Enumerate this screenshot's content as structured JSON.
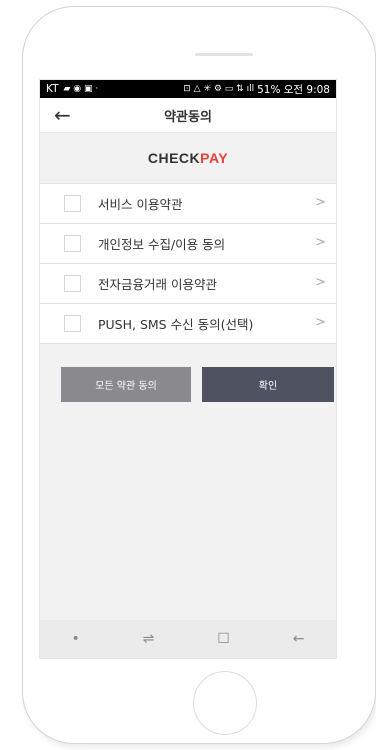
{
  "status": {
    "carrier": "KT",
    "right": "51% 오전 9:08"
  },
  "header": {
    "title": "약관동의"
  },
  "brand": {
    "part1": "CHECK",
    "part2": "PAY"
  },
  "terms": [
    {
      "label": "서비스 이용약관"
    },
    {
      "label": "개인정보 수집/이용 동의"
    },
    {
      "label": "전자금융거래 이용약관"
    },
    {
      "label": "PUSH, SMS 수신 동의(선택)"
    }
  ],
  "buttons": {
    "agree_all": "모든 약관 동의",
    "confirm": "확인"
  },
  "colors": {
    "brand_dark": "#333333",
    "brand_accent": "#e8403a",
    "agree_all_bg": "#8a8a8e",
    "confirm_bg": "#4f5260"
  }
}
